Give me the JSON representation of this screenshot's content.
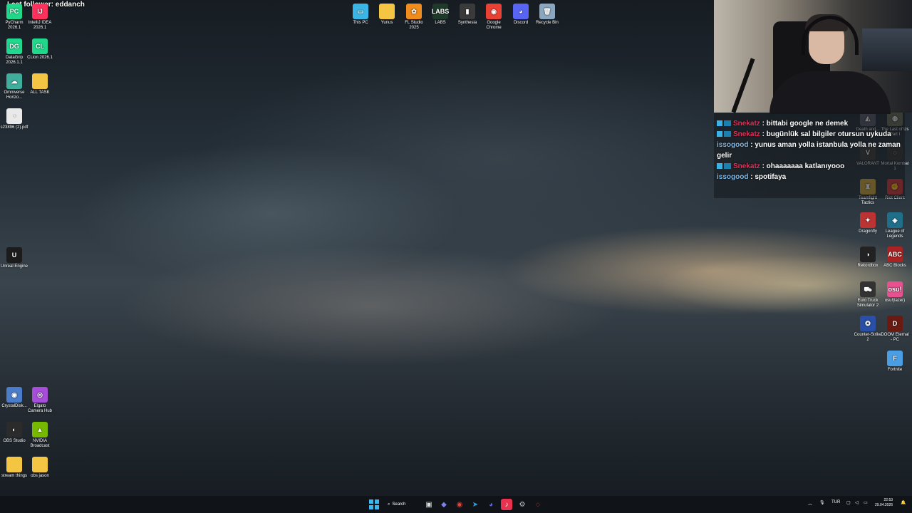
{
  "overlay": {
    "last_follower": "Last follower: eddanch"
  },
  "desktop_left": [
    {
      "label": "PyCharm 2026.1",
      "glyph": "PC",
      "color": "#21d789"
    },
    {
      "label": "IntelliJ IDEA 2026.1",
      "glyph": "IJ",
      "color": "#fe315d"
    },
    {
      "label": "DataGrip 2026.1.1",
      "glyph": "DG",
      "color": "#22d88f"
    },
    {
      "label": "CLion 2026.1",
      "glyph": "CL",
      "color": "#21d789"
    },
    {
      "label": "Omniverse Horizo...",
      "glyph": "☁",
      "color": "#3fae9c"
    },
    {
      "label": "ALL TASK",
      "glyph": "",
      "color": "#f4c542"
    },
    {
      "label": "s23896 (2).pdf",
      "glyph": "◔",
      "color": "#e9e9e9"
    },
    {
      "label": "Unreal Engine",
      "glyph": "U",
      "color": "#1c1c1c"
    },
    {
      "label": "CrystalDisk...",
      "glyph": "◉",
      "color": "#4a7cc9"
    },
    {
      "label": "Elgato Camera Hub",
      "glyph": "◎",
      "color": "#a64dd9"
    },
    {
      "label": "OBS Studio",
      "glyph": "◐",
      "color": "#2b2b2b"
    },
    {
      "label": "NVIDIA Broadcast",
      "glyph": "▲",
      "color": "#76b900"
    },
    {
      "label": "stream things",
      "glyph": "",
      "color": "#f4c542"
    },
    {
      "label": "obs jason",
      "glyph": "",
      "color": "#f4c542"
    }
  ],
  "desktop_top": [
    {
      "label": "This PC",
      "glyph": "▭",
      "color": "#3ab6e6"
    },
    {
      "label": "Yunus",
      "glyph": "",
      "color": "#f4c542"
    },
    {
      "label": "FL Studio 2025",
      "glyph": "✿",
      "color": "#f08c1c"
    },
    {
      "label": "LABS",
      "glyph": "LABS",
      "color": "#1f3a2a"
    },
    {
      "label": "Synthesia",
      "glyph": "▮",
      "color": "#3a3a3a"
    },
    {
      "label": "Google Chrome",
      "glyph": "◉",
      "color": "#e94235"
    },
    {
      "label": "Discord",
      "glyph": "◕",
      "color": "#5865f2"
    },
    {
      "label": "Recycle Bin",
      "glyph": "🗑",
      "color": "#8aa7bf"
    }
  ],
  "desktop_right": [
    {
      "label": "Death and...",
      "glyph": "◭",
      "color": "#556"
    },
    {
      "label": "The Last of Us Part I",
      "glyph": "◍",
      "color": "#665"
    },
    {
      "label": "VALORANT",
      "glyph": "V",
      "color": "#3a3a3a"
    },
    {
      "label": "Mortal Kombat 1",
      "glyph": "◌",
      "color": "#333"
    },
    {
      "label": "Teamfight Tactics",
      "glyph": "♜",
      "color": "#c9a23b"
    },
    {
      "label": "Riot Client",
      "glyph": "✊",
      "color": "#d13639"
    },
    {
      "label": "Dragonfly",
      "glyph": "✦",
      "color": "#b33"
    },
    {
      "label": "League of Legends",
      "glyph": "◈",
      "color": "#1f6f8b"
    },
    {
      "label": "Rekordbox",
      "glyph": "◑",
      "color": "#222"
    },
    {
      "label": "ABC Blocks",
      "glyph": "ABC",
      "color": "#a22"
    },
    {
      "label": "Euro Truck Simulator 2",
      "glyph": "⛟",
      "color": "#333"
    },
    {
      "label": "osu!(lazer)",
      "glyph": "osu!",
      "color": "#e8508f"
    },
    {
      "label": "Counter-Strike 2",
      "glyph": "✪",
      "color": "#2a4fa8"
    },
    {
      "label": "DOOM Eternal - PC",
      "glyph": "D",
      "color": "#6b1a12"
    },
    {
      "label": "Fortnite",
      "glyph": "F",
      "color": "#4a9ee3"
    }
  ],
  "chat": [
    {
      "user": "Snekatz",
      "user_color": "#e0325a",
      "badges": true,
      "message": ": bittabi google ne demek"
    },
    {
      "user": "Snekatz",
      "user_color": "#e0325a",
      "badges": true,
      "message": ": bugünlük sal bilgiler otursun uykuda"
    },
    {
      "user": "issogood",
      "user_color": "#7fb8e6",
      "badges": false,
      "message": ": yunus aman yolla istanbula yolla ne zaman gelir"
    },
    {
      "user": "Snekatz",
      "user_color": "#e0325a",
      "badges": true,
      "message": ": ohaaaaaaa katlanıyooo"
    },
    {
      "user": "issogood",
      "user_color": "#7fb8e6",
      "badges": false,
      "message": ": spotifaya"
    }
  ],
  "taskbar": {
    "search_label": "Search",
    "language": "TUR",
    "time": "22:53",
    "date": "29.04.2026"
  }
}
